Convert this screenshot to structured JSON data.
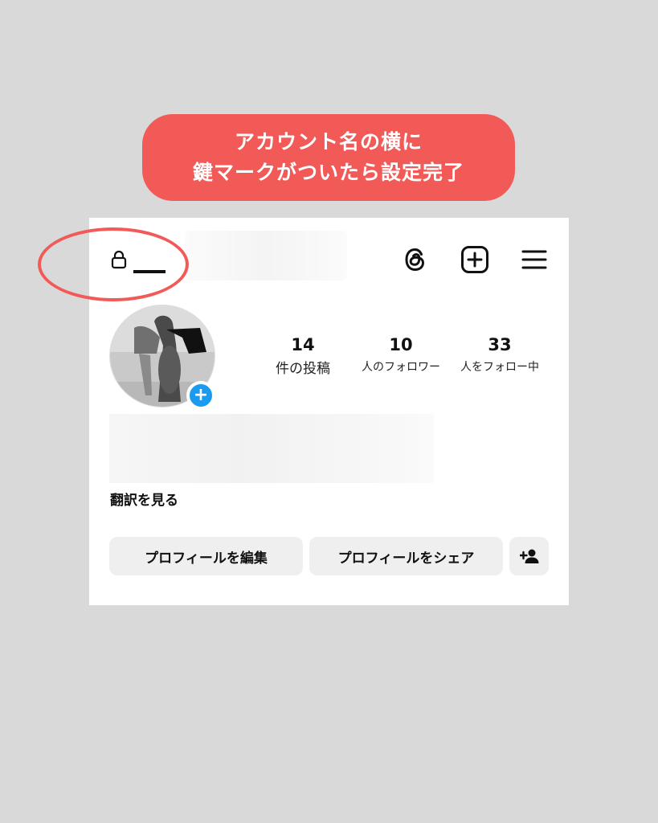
{
  "banner": {
    "line1": "アカウント名の横に",
    "line2": "鍵マークがついたら設定完了"
  },
  "header": {
    "icons": [
      "lock-icon",
      "threads-icon",
      "new-post-icon",
      "menu-icon"
    ]
  },
  "profile": {
    "stats": {
      "posts": {
        "value": "14",
        "label": "件の投稿"
      },
      "followers": {
        "value": "10",
        "label": "人のフォロワー"
      },
      "following": {
        "value": "33",
        "label": "人をフォロー中"
      }
    },
    "translate_link": "翻訳を見る",
    "add_story_symbol": "+"
  },
  "buttons": {
    "edit_profile": "プロフィールを編集",
    "share_profile": "プロフィールをシェア"
  },
  "colors": {
    "banner": "#f25a58",
    "highlight_ring": "#f25a58",
    "add_badge": "#1a9bf0",
    "button_bg": "#efefef"
  }
}
